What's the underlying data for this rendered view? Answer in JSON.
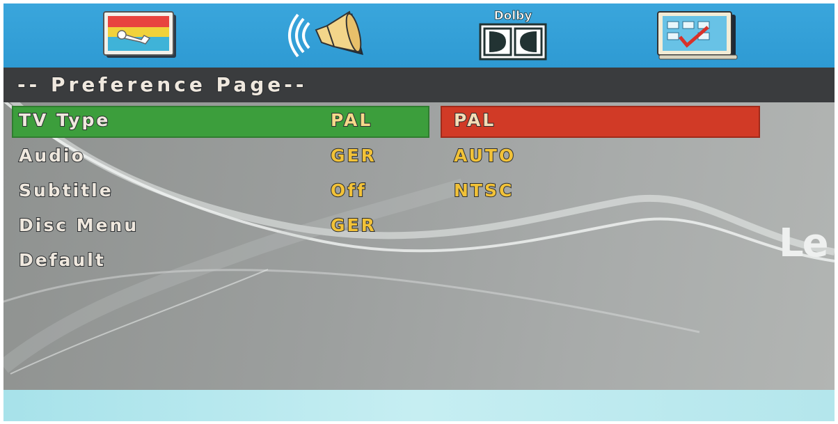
{
  "icon_bar": {
    "tabs": [
      {
        "icon": "general-setup-icon"
      },
      {
        "icon": "audio-speaker-icon"
      },
      {
        "icon": "dolby-digital-icon",
        "label": "Dolby"
      },
      {
        "icon": "preference-checklist-icon"
      }
    ]
  },
  "page_title": "-- Preference Page--",
  "menu": {
    "items": [
      {
        "label": "TV Type",
        "value": "PAL",
        "selected": true
      },
      {
        "label": "Audio",
        "value": "GER"
      },
      {
        "label": "Subtitle",
        "value": "Off"
      },
      {
        "label": "Disc Menu",
        "value": "GER"
      },
      {
        "label": "Default",
        "value": ""
      }
    ],
    "options": [
      "PAL",
      "AUTO",
      "NTSC"
    ]
  },
  "watermark": "Le",
  "colors": {
    "top_bar": "#3aa6dc",
    "title_bar": "#3a3c3e",
    "selected_row": "#3c9e3c",
    "selected_option": "#d13a26",
    "value_text": "#f2c238",
    "label_text": "#efe8de"
  }
}
